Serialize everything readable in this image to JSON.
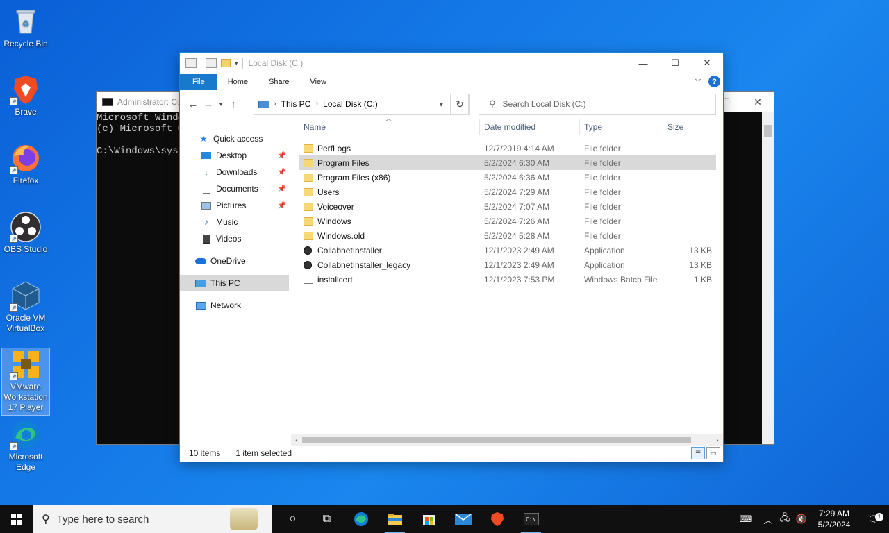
{
  "desktop": {
    "icons": [
      {
        "label": "Recycle Bin",
        "icon": "recycle-bin-icon"
      },
      {
        "label": "Brave",
        "icon": "brave-icon"
      },
      {
        "label": "Firefox",
        "icon": "firefox-icon"
      },
      {
        "label": "OBS Studio",
        "icon": "obs-icon"
      },
      {
        "label": "Oracle VM VirtualBox",
        "icon": "virtualbox-icon"
      },
      {
        "label": "VMware Workstation 17 Player",
        "icon": "vmware-icon"
      },
      {
        "label": "Microsoft Edge",
        "icon": "edge-icon"
      }
    ]
  },
  "cmd": {
    "title": "Administrator: Co",
    "lines": [
      "Microsoft Windo",
      "(c) Microsoft C",
      "",
      "C:\\Windows\\syst"
    ]
  },
  "explorer": {
    "title": "Local Disk (C:)",
    "ribbon": {
      "file": "File",
      "home": "Home",
      "share": "Share",
      "view": "View"
    },
    "address": {
      "crumbs": [
        "This PC",
        "Local Disk (C:)"
      ]
    },
    "search_placeholder": "Search Local Disk (C:)",
    "nav": {
      "quick_access": "Quick access",
      "desktop": "Desktop",
      "downloads": "Downloads",
      "documents": "Documents",
      "pictures": "Pictures",
      "music": "Music",
      "videos": "Videos",
      "onedrive": "OneDrive",
      "this_pc": "This PC",
      "network": "Network"
    },
    "columns": {
      "name": "Name",
      "date": "Date modified",
      "type": "Type",
      "size": "Size"
    },
    "files": [
      {
        "name": "PerfLogs",
        "date": "12/7/2019 4:14 AM",
        "type": "File folder",
        "size": "",
        "kind": "folder"
      },
      {
        "name": "Program Files",
        "date": "5/2/2024 6:30 AM",
        "type": "File folder",
        "size": "",
        "kind": "folder"
      },
      {
        "name": "Program Files (x86)",
        "date": "5/2/2024 6:36 AM",
        "type": "File folder",
        "size": "",
        "kind": "folder"
      },
      {
        "name": "Users",
        "date": "5/2/2024 7:29 AM",
        "type": "File folder",
        "size": "",
        "kind": "folder"
      },
      {
        "name": "Voiceover",
        "date": "5/2/2024 7:07 AM",
        "type": "File folder",
        "size": "",
        "kind": "folder"
      },
      {
        "name": "Windows",
        "date": "5/2/2024 7:26 AM",
        "type": "File folder",
        "size": "",
        "kind": "folder"
      },
      {
        "name": "Windows.old",
        "date": "5/2/2024 5:28 AM",
        "type": "File folder",
        "size": "",
        "kind": "folder"
      },
      {
        "name": "CollabnetInstaller",
        "date": "12/1/2023 2:49 AM",
        "type": "Application",
        "size": "13 KB",
        "kind": "app"
      },
      {
        "name": "CollabnetInstaller_legacy",
        "date": "12/1/2023 2:49 AM",
        "type": "Application",
        "size": "13 KB",
        "kind": "app"
      },
      {
        "name": "installcert",
        "date": "12/1/2023 7:53 PM",
        "type": "Windows Batch File",
        "size": "1 KB",
        "kind": "bat"
      }
    ],
    "selected_index": 1,
    "status": {
      "items": "10 items",
      "selected": "1 item selected"
    }
  },
  "taskbar": {
    "search_placeholder": "Type here to search",
    "time": "7:29 AM",
    "date": "5/2/2024",
    "notifications": "1"
  },
  "colors": {
    "accent": "#1979ca",
    "selection": "#d9d9d9",
    "taskbar": "#101010"
  }
}
